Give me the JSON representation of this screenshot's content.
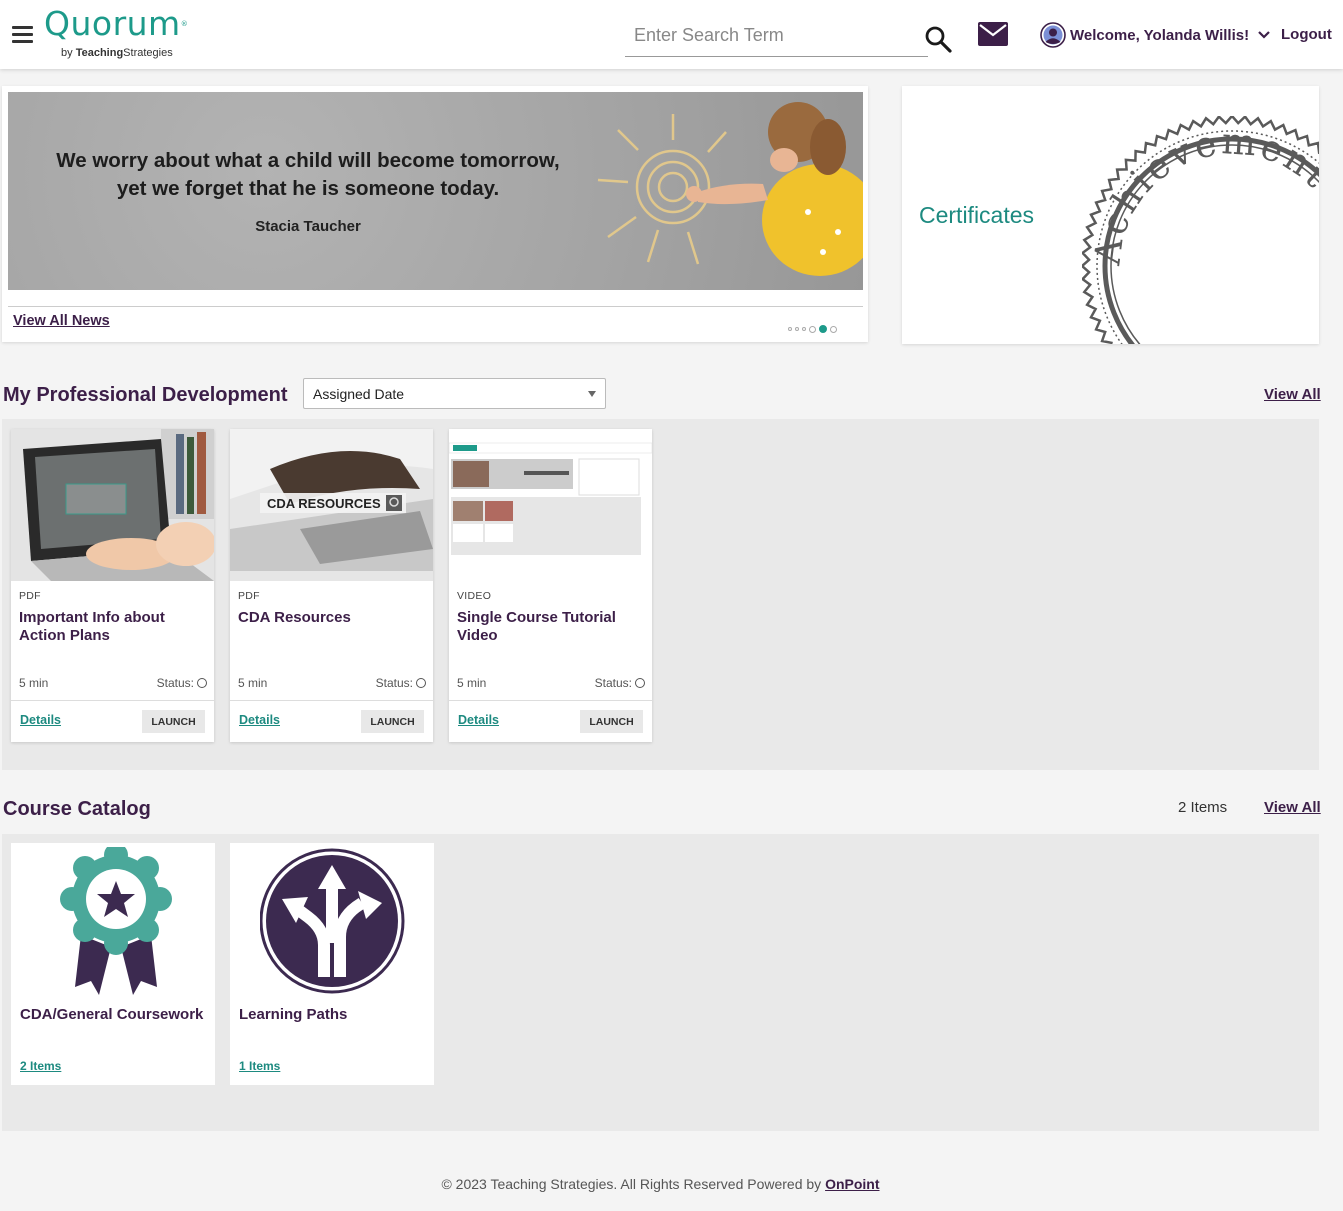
{
  "header": {
    "logo_text": "Quorum",
    "logo_sub_prefix": "by ",
    "logo_sub_brand": "Teaching",
    "logo_sub_suffix": "Strategies",
    "search_placeholder": "Enter Search Term",
    "welcome": "Welcome, Yolanda Willis!",
    "logout": "Logout"
  },
  "news": {
    "quote_line1": "We worry about what a child will become tomorrow,",
    "quote_line2": "yet we forget that he is someone today.",
    "author": "Stacia Taucher",
    "view_all": "View All News",
    "slide_count": 6,
    "active_slide": 4
  },
  "certificates": {
    "title": "Certificates",
    "seal_text": "Achievement • Ex"
  },
  "pd": {
    "title": "My Professional Development",
    "sort_value": "Assigned Date",
    "view_all": "View All",
    "courses": [
      {
        "type": "PDF",
        "title": "Important Info about Action Plans",
        "duration": "5 min",
        "status_label": "Status:",
        "details": "Details",
        "launch": "LAUNCH"
      },
      {
        "type": "PDF",
        "title": "CDA Resources",
        "duration": "5 min",
        "status_label": "Status:",
        "details": "Details",
        "launch": "LAUNCH",
        "thumb_text": "CDA RESOURCES"
      },
      {
        "type": "VIDEO",
        "title": "Single Course Tutorial Video",
        "duration": "5 min",
        "status_label": "Status:",
        "details": "Details",
        "launch": "LAUNCH"
      }
    ]
  },
  "catalog": {
    "title": "Course Catalog",
    "count": "2 Items",
    "view_all": "View All",
    "items": [
      {
        "title": "CDA/General Coursework",
        "count": "2 Items"
      },
      {
        "title": "Learning Paths",
        "count": "1 Items"
      }
    ]
  },
  "footer": {
    "text": "© 2023 Teaching Strategies. All Rights Reserved Powered by ",
    "link": "OnPoint"
  },
  "colors": {
    "brand_teal": "#1d9a8a",
    "brand_purple": "#3c1f48",
    "panel_gray": "#e9e9e9"
  }
}
